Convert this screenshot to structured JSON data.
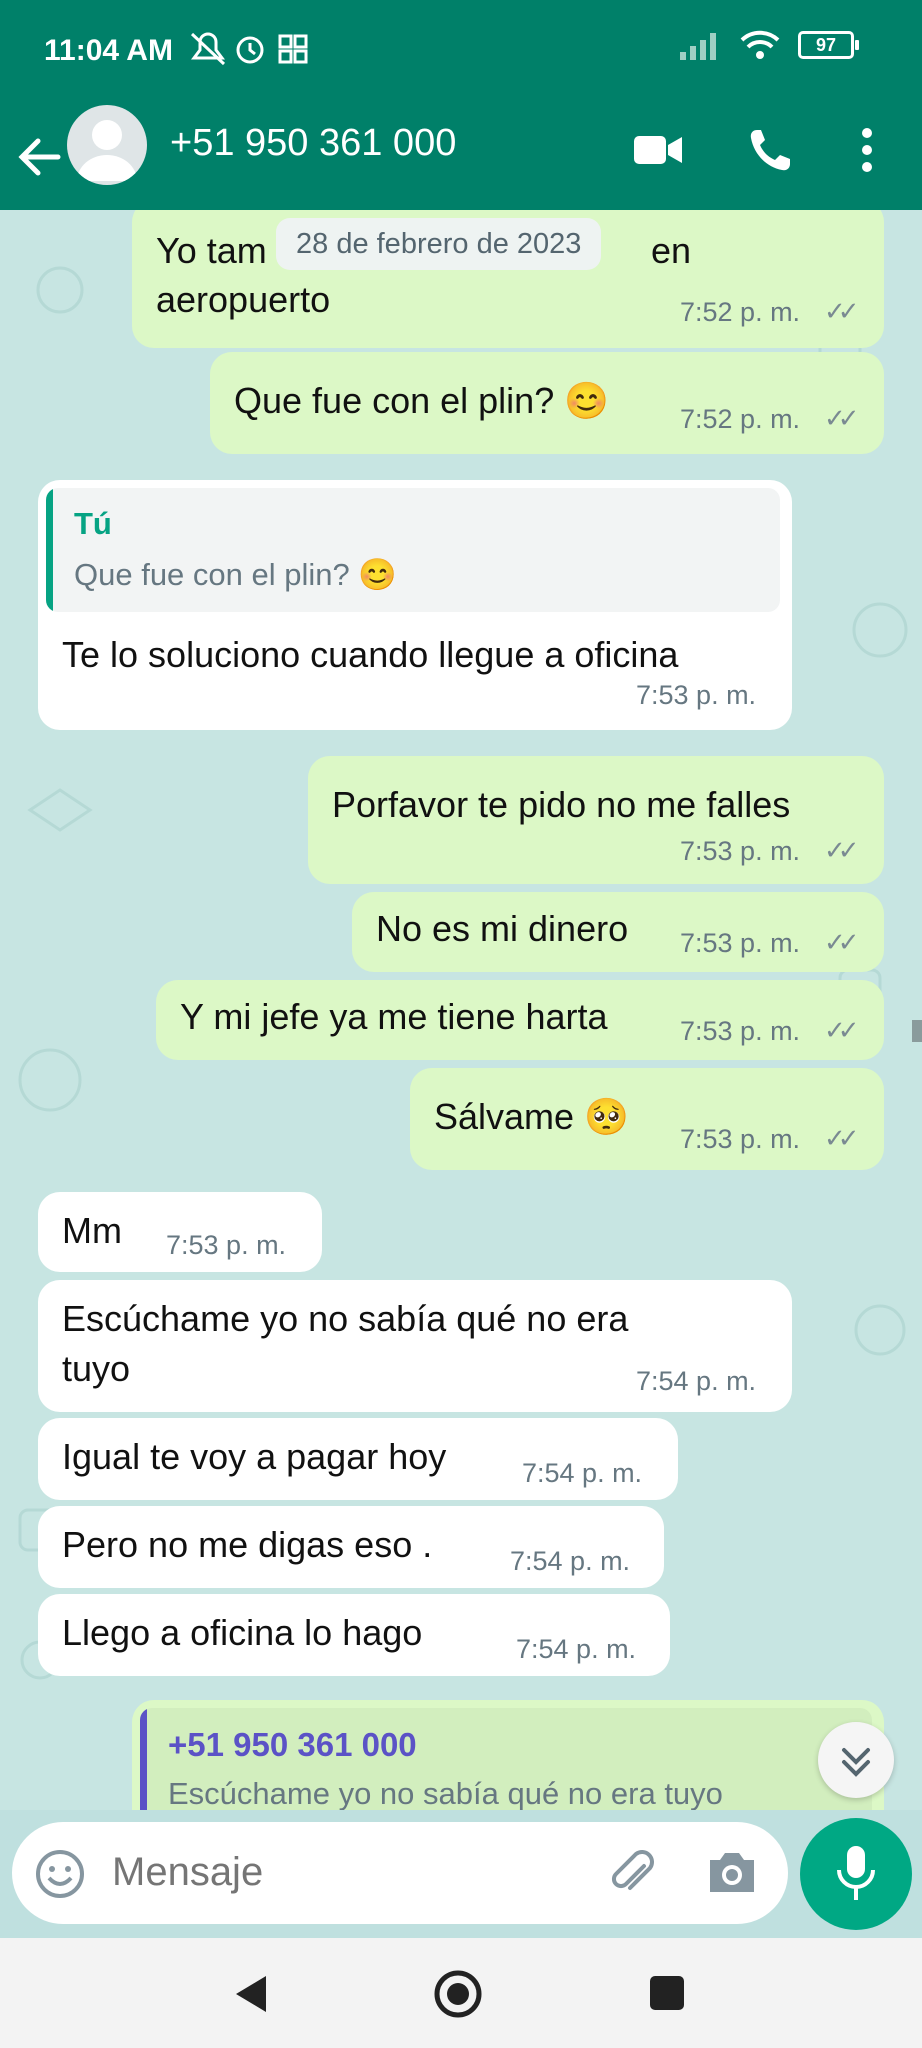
{
  "status_bar": {
    "time": "11:04 AM",
    "battery": "97"
  },
  "header": {
    "contact": "+51 950 361 000"
  },
  "chat": {
    "date_chip": "28 de febrero de 2023",
    "messages": [
      {
        "dir": "out",
        "text1": "Yo tam",
        "text1b": "en",
        "text2": "aeropuerto",
        "time": "7:52 p. m."
      },
      {
        "dir": "out",
        "text": "Que fue con el plin? 😊",
        "time": "7:52 p. m."
      },
      {
        "dir": "in",
        "quote_author": "Tú",
        "quote_text": "Que fue con el plin? 😊",
        "text": "Te lo soluciono cuando llegue a oficina",
        "time": "7:53 p. m."
      },
      {
        "dir": "out",
        "text": "Porfavor te pido no me falles",
        "time": "7:53 p. m."
      },
      {
        "dir": "out",
        "text": "No es mi dinero",
        "time": "7:53 p. m."
      },
      {
        "dir": "out",
        "text": "Y mi jefe ya me tiene harta",
        "time": "7:53 p. m."
      },
      {
        "dir": "out",
        "text": "Sálvame 🥺",
        "time": "7:53 p. m."
      },
      {
        "dir": "in",
        "text": "Mm",
        "time": "7:53 p. m."
      },
      {
        "dir": "in",
        "text1": "Escúchame yo no sabía qué no era",
        "text2": "tuyo",
        "time": "7:54 p. m."
      },
      {
        "dir": "in",
        "text": "Igual te voy a pagar hoy",
        "time": "7:54 p. m."
      },
      {
        "dir": "in",
        "text": "Pero no me digas eso .",
        "time": "7:54 p. m."
      },
      {
        "dir": "in",
        "text": "Llego a oficina  lo hago",
        "time": "7:54 p. m."
      },
      {
        "dir": "out",
        "quote_author": "+51 950 361 000",
        "quote_text": "Escúchame yo no sabía qué no era tuyo"
      }
    ]
  },
  "composer": {
    "placeholder": "Mensaje"
  },
  "colors": {
    "header": "#008069",
    "outgoing": "#dcf8c6",
    "incoming": "#ffffff",
    "accent": "#00a884",
    "read_ticks": "#7a8a92"
  },
  "icons": [
    "back-icon",
    "avatar-icon",
    "video-call-icon",
    "phone-icon",
    "more-icon",
    "emoji-icon",
    "attach-icon",
    "camera-icon",
    "mic-icon",
    "scroll-down-icon",
    "nav-back-icon",
    "nav-home-icon",
    "nav-recents-icon"
  ]
}
